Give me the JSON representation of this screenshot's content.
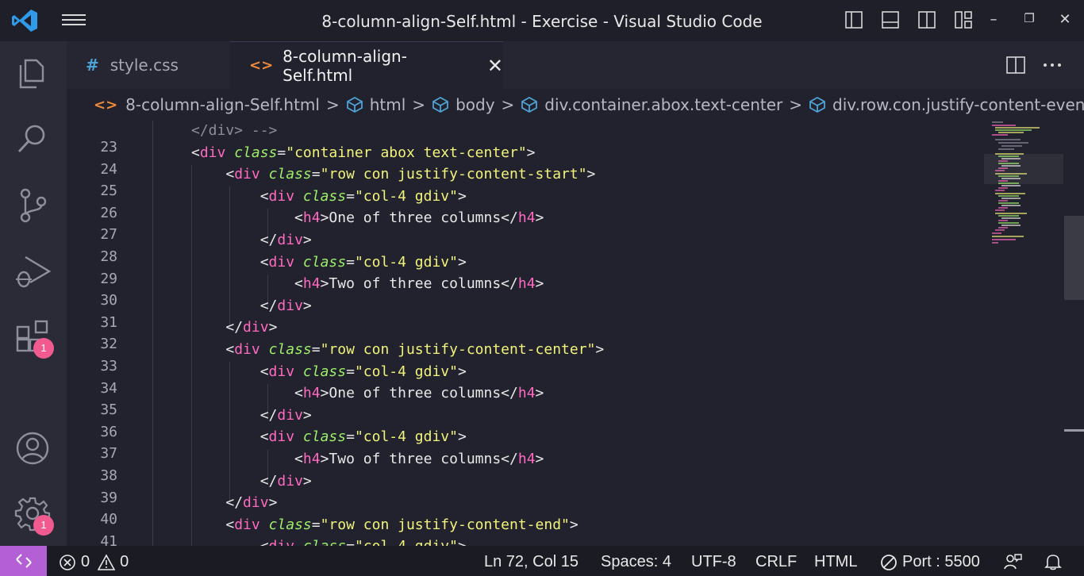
{
  "window": {
    "title": "8-column-align-Self.html - Exercise - Visual Studio Code",
    "minimize": "–",
    "restore": "❐",
    "close": "✕"
  },
  "badges": {
    "extensions": "1",
    "settings": "1"
  },
  "tabs": [
    {
      "icon": "#",
      "label": "style.css",
      "active": false
    },
    {
      "icon": "<>",
      "label": "8-column-align-Self.html",
      "active": true,
      "close": "✕"
    }
  ],
  "breadcrumb": {
    "file": "8-column-align-Self.html",
    "items": [
      "html",
      "body",
      "div.container.abox.text-center",
      "div.row.con.justify-content-evenly"
    ],
    "separator": ">"
  },
  "code": {
    "lines": [
      {
        "n": "23"
      },
      {
        "n": "24"
      },
      {
        "n": "25"
      },
      {
        "n": "26"
      },
      {
        "n": "27"
      },
      {
        "n": "28"
      },
      {
        "n": "29"
      },
      {
        "n": "30"
      },
      {
        "n": "31"
      },
      {
        "n": "32"
      },
      {
        "n": "33"
      },
      {
        "n": "34"
      },
      {
        "n": "35"
      },
      {
        "n": "36"
      },
      {
        "n": "37"
      },
      {
        "n": "38"
      },
      {
        "n": "39"
      },
      {
        "n": "40"
      },
      {
        "n": "41"
      }
    ],
    "strings": {
      "comment_end": "</div> -->",
      "container_class": "\"container abox text-center\"",
      "row_start": "\"row con justify-content-start\"",
      "row_center": "\"row con justify-content-center\"",
      "row_end": "\"row con justify-content-end\"",
      "col": "\"col-4 gdiv\"",
      "one": "One of three columns",
      "two": "Two of three columns"
    }
  },
  "status": {
    "errors": "0",
    "warnings": "0",
    "position": "Ln 72, Col 15",
    "spaces": "Spaces: 4",
    "encoding": "UTF-8",
    "eol": "CRLF",
    "language": "HTML",
    "port": "Port : 5500"
  },
  "colors": {
    "tag": "#ff6ac1",
    "attribute": "#9ef06a",
    "string": "#f1f37a",
    "remote": "#b45fd6",
    "badge": "#f05a8e"
  }
}
